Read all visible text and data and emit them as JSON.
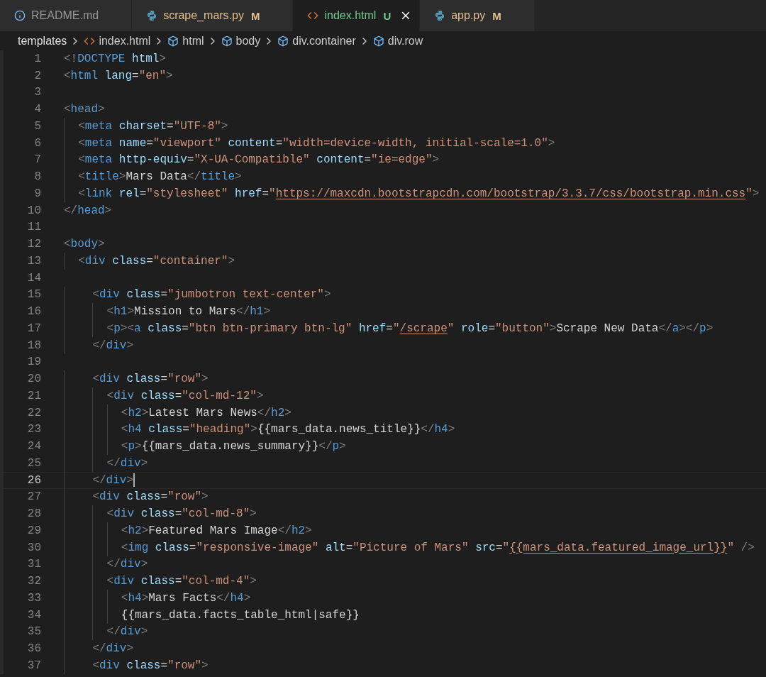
{
  "tabs": [
    {
      "label": "README.md",
      "kind": "markdown",
      "color": "#969696",
      "selected": false
    },
    {
      "label": "scrape_mars.py",
      "kind": "python",
      "color": "#e2c08d",
      "badge": "M",
      "selected": false
    },
    {
      "label": "index.html",
      "kind": "html",
      "color": "#73c991",
      "badge": "U",
      "selected": true
    },
    {
      "label": "app.py",
      "kind": "python",
      "color": "#e2c08d",
      "badge": "M",
      "selected": false
    }
  ],
  "breadcrumbs": [
    {
      "label": "templates",
      "kind": "folder"
    },
    {
      "label": "index.html",
      "kind": "file"
    },
    {
      "label": "html",
      "kind": "element"
    },
    {
      "label": "body",
      "kind": "element"
    },
    {
      "label": "div.container",
      "kind": "element"
    },
    {
      "label": "div.row",
      "kind": "element"
    }
  ],
  "lines": [
    {
      "number": "1",
      "current": false,
      "tokens": [
        {
          "kind": "p",
          "text": "<!"
        },
        {
          "kind": "t",
          "text": "DOCTYPE"
        },
        {
          "kind": "a",
          "text": " html"
        },
        {
          "kind": "p",
          "text": ">"
        }
      ]
    },
    {
      "number": "2",
      "current": false,
      "tokens": [
        {
          "kind": "p",
          "text": "<"
        },
        {
          "kind": "t",
          "text": "html"
        },
        {
          "kind": "a",
          "text": " lang"
        },
        {
          "kind": "x",
          "text": "="
        },
        {
          "kind": "s",
          "text": "\"en\""
        },
        {
          "kind": "p",
          "text": ">"
        }
      ]
    },
    {
      "number": "3",
      "current": false
    },
    {
      "number": "4",
      "current": false,
      "tokens": [
        {
          "kind": "p",
          "text": "<"
        },
        {
          "kind": "t",
          "text": "head"
        },
        {
          "kind": "p",
          "text": ">"
        }
      ]
    },
    {
      "number": "5",
      "current": false,
      "tokens": [
        {
          "kind": "p",
          "text": "  <"
        },
        {
          "kind": "t",
          "text": "meta"
        },
        {
          "kind": "a",
          "text": " charset"
        },
        {
          "kind": "x",
          "text": "="
        },
        {
          "kind": "s",
          "text": "\"UTF-8\""
        },
        {
          "kind": "p",
          "text": ">"
        }
      ]
    },
    {
      "number": "6",
      "current": false,
      "tokens": [
        {
          "kind": "p",
          "text": "  <"
        },
        {
          "kind": "t",
          "text": "meta"
        },
        {
          "kind": "a",
          "text": " name"
        },
        {
          "kind": "x",
          "text": "="
        },
        {
          "kind": "s",
          "text": "\"viewport\""
        },
        {
          "kind": "a",
          "text": " content"
        },
        {
          "kind": "x",
          "text": "="
        },
        {
          "kind": "s",
          "text": "\"width=device-width, initial-scale=1.0\""
        },
        {
          "kind": "p",
          "text": ">"
        }
      ]
    },
    {
      "number": "7",
      "current": false,
      "tokens": [
        {
          "kind": "p",
          "text": "  <"
        },
        {
          "kind": "t",
          "text": "meta"
        },
        {
          "kind": "a",
          "text": " http-equiv"
        },
        {
          "kind": "x",
          "text": "="
        },
        {
          "kind": "s",
          "text": "\"X-UA-Compatible\""
        },
        {
          "kind": "a",
          "text": " content"
        },
        {
          "kind": "x",
          "text": "="
        },
        {
          "kind": "s",
          "text": "\"ie=edge\""
        },
        {
          "kind": "p",
          "text": ">"
        }
      ]
    },
    {
      "number": "8",
      "current": false,
      "tokens": [
        {
          "kind": "p",
          "text": "  <"
        },
        {
          "kind": "t",
          "text": "title"
        },
        {
          "kind": "p",
          "text": ">"
        },
        {
          "kind": "x",
          "text": "Mars Data"
        },
        {
          "kind": "p",
          "text": "</"
        },
        {
          "kind": "t",
          "text": "title"
        },
        {
          "kind": "p",
          "text": ">"
        }
      ]
    },
    {
      "number": "9",
      "current": false,
      "tokens": [
        {
          "kind": "p",
          "text": "  <"
        },
        {
          "kind": "t",
          "text": "link"
        },
        {
          "kind": "a",
          "text": " rel"
        },
        {
          "kind": "x",
          "text": "="
        },
        {
          "kind": "s",
          "text": "\"stylesheet\""
        },
        {
          "kind": "a",
          "text": " href"
        },
        {
          "kind": "x",
          "text": "="
        },
        {
          "kind": "s",
          "text": "\""
        },
        {
          "kind": "u",
          "text": "https://maxcdn.bootstrapcdn.com/bootstrap/3.3.7/css/bootstrap.min.css"
        },
        {
          "kind": "s",
          "text": "\""
        },
        {
          "kind": "p",
          "text": ">"
        }
      ]
    },
    {
      "number": "10",
      "current": false,
      "tokens": [
        {
          "kind": "p",
          "text": "</"
        },
        {
          "kind": "t",
          "text": "head"
        },
        {
          "kind": "p",
          "text": ">"
        }
      ]
    },
    {
      "number": "11",
      "current": false
    },
    {
      "number": "12",
      "current": false,
      "tokens": [
        {
          "kind": "p",
          "text": "<"
        },
        {
          "kind": "t",
          "text": "body"
        },
        {
          "kind": "p",
          "text": ">"
        }
      ]
    },
    {
      "number": "13",
      "current": false,
      "tokens": [
        {
          "kind": "p",
          "text": "  <"
        },
        {
          "kind": "t",
          "text": "div"
        },
        {
          "kind": "a",
          "text": " class"
        },
        {
          "kind": "x",
          "text": "="
        },
        {
          "kind": "s",
          "text": "\"container\""
        },
        {
          "kind": "p",
          "text": ">"
        }
      ]
    },
    {
      "number": "14",
      "current": false
    },
    {
      "number": "15",
      "current": false,
      "tokens": [
        {
          "kind": "p",
          "text": "    <"
        },
        {
          "kind": "t",
          "text": "div"
        },
        {
          "kind": "a",
          "text": " class"
        },
        {
          "kind": "x",
          "text": "="
        },
        {
          "kind": "s",
          "text": "\"jumbotron text-center\""
        },
        {
          "kind": "p",
          "text": ">"
        }
      ]
    },
    {
      "number": "16",
      "current": false,
      "tokens": [
        {
          "kind": "p",
          "text": "      <"
        },
        {
          "kind": "t",
          "text": "h1"
        },
        {
          "kind": "p",
          "text": ">"
        },
        {
          "kind": "x",
          "text": "Mission to Mars"
        },
        {
          "kind": "p",
          "text": "</"
        },
        {
          "kind": "t",
          "text": "h1"
        },
        {
          "kind": "p",
          "text": ">"
        }
      ]
    },
    {
      "number": "17",
      "current": false,
      "tokens": [
        {
          "kind": "p",
          "text": "      <"
        },
        {
          "kind": "t",
          "text": "p"
        },
        {
          "kind": "p",
          "text": "><"
        },
        {
          "kind": "t",
          "text": "a"
        },
        {
          "kind": "a",
          "text": " class"
        },
        {
          "kind": "x",
          "text": "="
        },
        {
          "kind": "s",
          "text": "\"btn btn-primary btn-lg\""
        },
        {
          "kind": "a",
          "text": " href"
        },
        {
          "kind": "x",
          "text": "="
        },
        {
          "kind": "s",
          "text": "\""
        },
        {
          "kind": "u",
          "text": "/scrape"
        },
        {
          "kind": "s",
          "text": "\""
        },
        {
          "kind": "a",
          "text": " role"
        },
        {
          "kind": "x",
          "text": "="
        },
        {
          "kind": "s",
          "text": "\"button\""
        },
        {
          "kind": "p",
          "text": ">"
        },
        {
          "kind": "x",
          "text": "Scrape New Data"
        },
        {
          "kind": "p",
          "text": "</"
        },
        {
          "kind": "t",
          "text": "a"
        },
        {
          "kind": "p",
          "text": "></"
        },
        {
          "kind": "t",
          "text": "p"
        },
        {
          "kind": "p",
          "text": ">"
        }
      ]
    },
    {
      "number": "18",
      "current": false,
      "tokens": [
        {
          "kind": "p",
          "text": "    </"
        },
        {
          "kind": "t",
          "text": "div"
        },
        {
          "kind": "p",
          "text": ">"
        }
      ]
    },
    {
      "number": "19",
      "current": false
    },
    {
      "number": "20",
      "current": false,
      "tokens": [
        {
          "kind": "p",
          "text": "    <"
        },
        {
          "kind": "t",
          "text": "div"
        },
        {
          "kind": "a",
          "text": " class"
        },
        {
          "kind": "x",
          "text": "="
        },
        {
          "kind": "s",
          "text": "\"row\""
        },
        {
          "kind": "p",
          "text": ">"
        }
      ]
    },
    {
      "number": "21",
      "current": false,
      "tokens": [
        {
          "kind": "p",
          "text": "      <"
        },
        {
          "kind": "t",
          "text": "div"
        },
        {
          "kind": "a",
          "text": " class"
        },
        {
          "kind": "x",
          "text": "="
        },
        {
          "kind": "s",
          "text": "\"col-md-12\""
        },
        {
          "kind": "p",
          "text": ">"
        }
      ]
    },
    {
      "number": "22",
      "current": false,
      "tokens": [
        {
          "kind": "p",
          "text": "        <"
        },
        {
          "kind": "t",
          "text": "h2"
        },
        {
          "kind": "p",
          "text": ">"
        },
        {
          "kind": "x",
          "text": "Latest Mars News"
        },
        {
          "kind": "p",
          "text": "</"
        },
        {
          "kind": "t",
          "text": "h2"
        },
        {
          "kind": "p",
          "text": ">"
        }
      ]
    },
    {
      "number": "23",
      "current": false,
      "tokens": [
        {
          "kind": "p",
          "text": "        <"
        },
        {
          "kind": "t",
          "text": "h4"
        },
        {
          "kind": "a",
          "text": " class"
        },
        {
          "kind": "x",
          "text": "="
        },
        {
          "kind": "s",
          "text": "\"heading\""
        },
        {
          "kind": "p",
          "text": ">"
        },
        {
          "kind": "x",
          "text": "{{mars_data.news_title}}"
        },
        {
          "kind": "p",
          "text": "</"
        },
        {
          "kind": "t",
          "text": "h4"
        },
        {
          "kind": "p",
          "text": ">"
        }
      ]
    },
    {
      "number": "24",
      "current": false,
      "tokens": [
        {
          "kind": "p",
          "text": "        <"
        },
        {
          "kind": "t",
          "text": "p"
        },
        {
          "kind": "p",
          "text": ">"
        },
        {
          "kind": "x",
          "text": "{{mars_data.news_summary}}"
        },
        {
          "kind": "p",
          "text": "</"
        },
        {
          "kind": "t",
          "text": "p"
        },
        {
          "kind": "p",
          "text": ">"
        }
      ]
    },
    {
      "number": "25",
      "current": false,
      "tokens": [
        {
          "kind": "p",
          "text": "      </"
        },
        {
          "kind": "t",
          "text": "div"
        },
        {
          "kind": "p",
          "text": ">"
        }
      ]
    },
    {
      "number": "26",
      "current": true,
      "tokens": [
        {
          "kind": "p",
          "text": "    </"
        },
        {
          "kind": "t",
          "text": "div"
        },
        {
          "kind": "p",
          "text": ">"
        }
      ]
    },
    {
      "number": "27",
      "current": false,
      "tokens": [
        {
          "kind": "p",
          "text": "    <"
        },
        {
          "kind": "t",
          "text": "div"
        },
        {
          "kind": "a",
          "text": " class"
        },
        {
          "kind": "x",
          "text": "="
        },
        {
          "kind": "s",
          "text": "\"row\""
        },
        {
          "kind": "p",
          "text": ">"
        }
      ]
    },
    {
      "number": "28",
      "current": false,
      "tokens": [
        {
          "kind": "p",
          "text": "      <"
        },
        {
          "kind": "t",
          "text": "div"
        },
        {
          "kind": "a",
          "text": " class"
        },
        {
          "kind": "x",
          "text": "="
        },
        {
          "kind": "s",
          "text": "\"col-md-8\""
        },
        {
          "kind": "p",
          "text": ">"
        }
      ]
    },
    {
      "number": "29",
      "current": false,
      "tokens": [
        {
          "kind": "p",
          "text": "        <"
        },
        {
          "kind": "t",
          "text": "h2"
        },
        {
          "kind": "p",
          "text": ">"
        },
        {
          "kind": "x",
          "text": "Featured Mars Image"
        },
        {
          "kind": "p",
          "text": "</"
        },
        {
          "kind": "t",
          "text": "h2"
        },
        {
          "kind": "p",
          "text": ">"
        }
      ]
    },
    {
      "number": "30",
      "current": false,
      "tokens": [
        {
          "kind": "p",
          "text": "        <"
        },
        {
          "kind": "t",
          "text": "img"
        },
        {
          "kind": "a",
          "text": " class"
        },
        {
          "kind": "x",
          "text": "="
        },
        {
          "kind": "s",
          "text": "\"responsive-image\""
        },
        {
          "kind": "a",
          "text": " alt"
        },
        {
          "kind": "x",
          "text": "="
        },
        {
          "kind": "s",
          "text": "\"Picture of Mars\""
        },
        {
          "kind": "a",
          "text": " src"
        },
        {
          "kind": "x",
          "text": "="
        },
        {
          "kind": "s",
          "text": "\""
        },
        {
          "kind": "u",
          "text": "{{mars_data.featured_image_url}}"
        },
        {
          "kind": "s",
          "text": "\""
        },
        {
          "kind": "p",
          "text": " />"
        }
      ]
    },
    {
      "number": "31",
      "current": false,
      "tokens": [
        {
          "kind": "p",
          "text": "      </"
        },
        {
          "kind": "t",
          "text": "div"
        },
        {
          "kind": "p",
          "text": ">"
        }
      ]
    },
    {
      "number": "32",
      "current": false,
      "tokens": [
        {
          "kind": "p",
          "text": "      <"
        },
        {
          "kind": "t",
          "text": "div"
        },
        {
          "kind": "a",
          "text": " class"
        },
        {
          "kind": "x",
          "text": "="
        },
        {
          "kind": "s",
          "text": "\"col-md-4\""
        },
        {
          "kind": "p",
          "text": ">"
        }
      ]
    },
    {
      "number": "33",
      "current": false,
      "tokens": [
        {
          "kind": "p",
          "text": "        <"
        },
        {
          "kind": "t",
          "text": "h4"
        },
        {
          "kind": "p",
          "text": ">"
        },
        {
          "kind": "x",
          "text": "Mars Facts"
        },
        {
          "kind": "p",
          "text": "</"
        },
        {
          "kind": "t",
          "text": "h4"
        },
        {
          "kind": "p",
          "text": ">"
        }
      ]
    },
    {
      "number": "34",
      "current": false,
      "tokens": [
        {
          "kind": "x",
          "text": "        {{mars_data.facts_table_html|safe}}"
        }
      ]
    },
    {
      "number": "35",
      "current": false,
      "tokens": [
        {
          "kind": "p",
          "text": "      </"
        },
        {
          "kind": "t",
          "text": "div"
        },
        {
          "kind": "p",
          "text": ">"
        }
      ]
    },
    {
      "number": "36",
      "current": false,
      "tokens": [
        {
          "kind": "p",
          "text": "    </"
        },
        {
          "kind": "t",
          "text": "div"
        },
        {
          "kind": "p",
          "text": ">"
        }
      ]
    },
    {
      "number": "37",
      "current": false,
      "tokens": [
        {
          "kind": "p",
          "text": "    <"
        },
        {
          "kind": "t",
          "text": "div"
        },
        {
          "kind": "a",
          "text": " class"
        },
        {
          "kind": "x",
          "text": "="
        },
        {
          "kind": "s",
          "text": "\"row\""
        },
        {
          "kind": "p",
          "text": ">"
        }
      ]
    }
  ]
}
